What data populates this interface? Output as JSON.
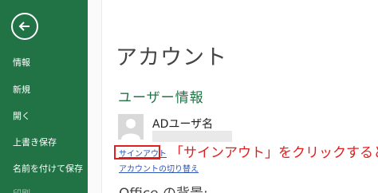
{
  "nav": {
    "items": [
      {
        "label": "情報"
      },
      {
        "label": "新規"
      },
      {
        "label": "開く"
      },
      {
        "label": "上書き保存"
      },
      {
        "label": "名前を付けて保存"
      },
      {
        "label": "印刷"
      }
    ]
  },
  "main": {
    "title": "アカウント",
    "section_title": "ユーザー情報",
    "user_name": "ADユーザ名",
    "sign_out_link": "サインアウト",
    "switch_account_link": "アカウントの切り替え",
    "office_background_heading": "Office の背景:"
  },
  "annotation": {
    "callout": "「サインアウト」をクリックすると"
  },
  "colors": {
    "nav_background": "#217346",
    "accent_green": "#217346",
    "link_blue": "#2b56b8",
    "highlight_red": "#e02020"
  },
  "icons": {
    "back": "back-arrow-icon",
    "avatar": "person-silhouette-icon"
  }
}
